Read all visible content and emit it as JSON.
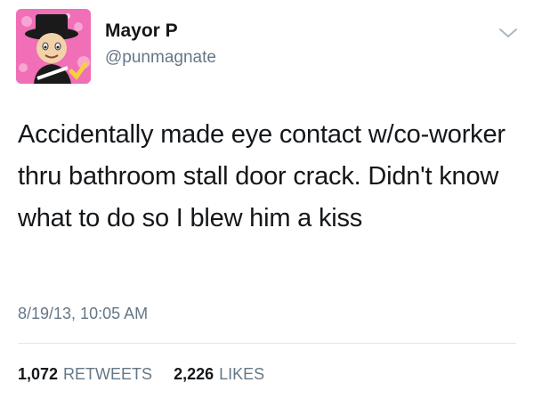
{
  "tweet": {
    "author": {
      "display_name": "Mayor P",
      "username": "@punmagnate",
      "avatar_icon": "mii-avatar-top-hat"
    },
    "menu_icon": "chevron-down-icon",
    "text": "Accidentally made eye contact w/co-worker thru bathroom stall door crack. Didn't know what to do so I blew him a kiss",
    "timestamp": "8/19/13, 10:05 AM",
    "stats": {
      "retweets_count": "1,072",
      "retweets_label": "RETWEETS",
      "likes_count": "2,226",
      "likes_label": "LIKES"
    }
  },
  "colors": {
    "text_primary": "#14171a",
    "text_secondary": "#657786",
    "divider": "#e1e8ed",
    "avatar_background": "#f06fb6"
  }
}
